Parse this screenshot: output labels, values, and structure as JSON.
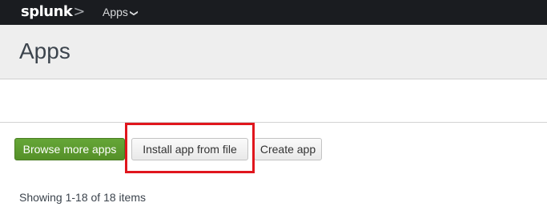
{
  "topbar": {
    "logo_text": "splunk",
    "logo_chevron": ">",
    "apps_menu_label": "Apps",
    "apps_menu_icon": "chevron-down-icon"
  },
  "header": {
    "title": "Apps"
  },
  "actions": {
    "browse_label": "Browse more apps",
    "install_label": "Install app from file",
    "create_label": "Create app"
  },
  "annotation": {
    "highlight_color": "#e0161d"
  },
  "list": {
    "status_text": "Showing 1-18 of 18 items"
  },
  "colors": {
    "topbar_bg": "#1a1c20",
    "primary_button": "#65a637",
    "header_bg": "#eeeeee"
  }
}
